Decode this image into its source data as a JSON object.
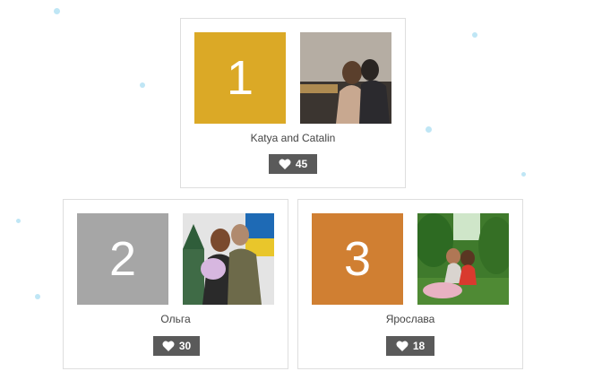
{
  "entries": [
    {
      "rank": "1",
      "name": "Katya and Catalin",
      "likes": "45",
      "rank_color": "#dba926",
      "photo_icon": "couple-sunset-photo"
    },
    {
      "rank": "2",
      "name": "Ольга",
      "likes": "30",
      "rank_color": "#a6a6a6",
      "photo_icon": "couple-soldier-photo"
    },
    {
      "rank": "3",
      "name": "Ярослава",
      "likes": "18",
      "rank_color": "#d07f32",
      "photo_icon": "couple-forest-photo"
    }
  ],
  "icons": {
    "like": "heart-icon"
  }
}
